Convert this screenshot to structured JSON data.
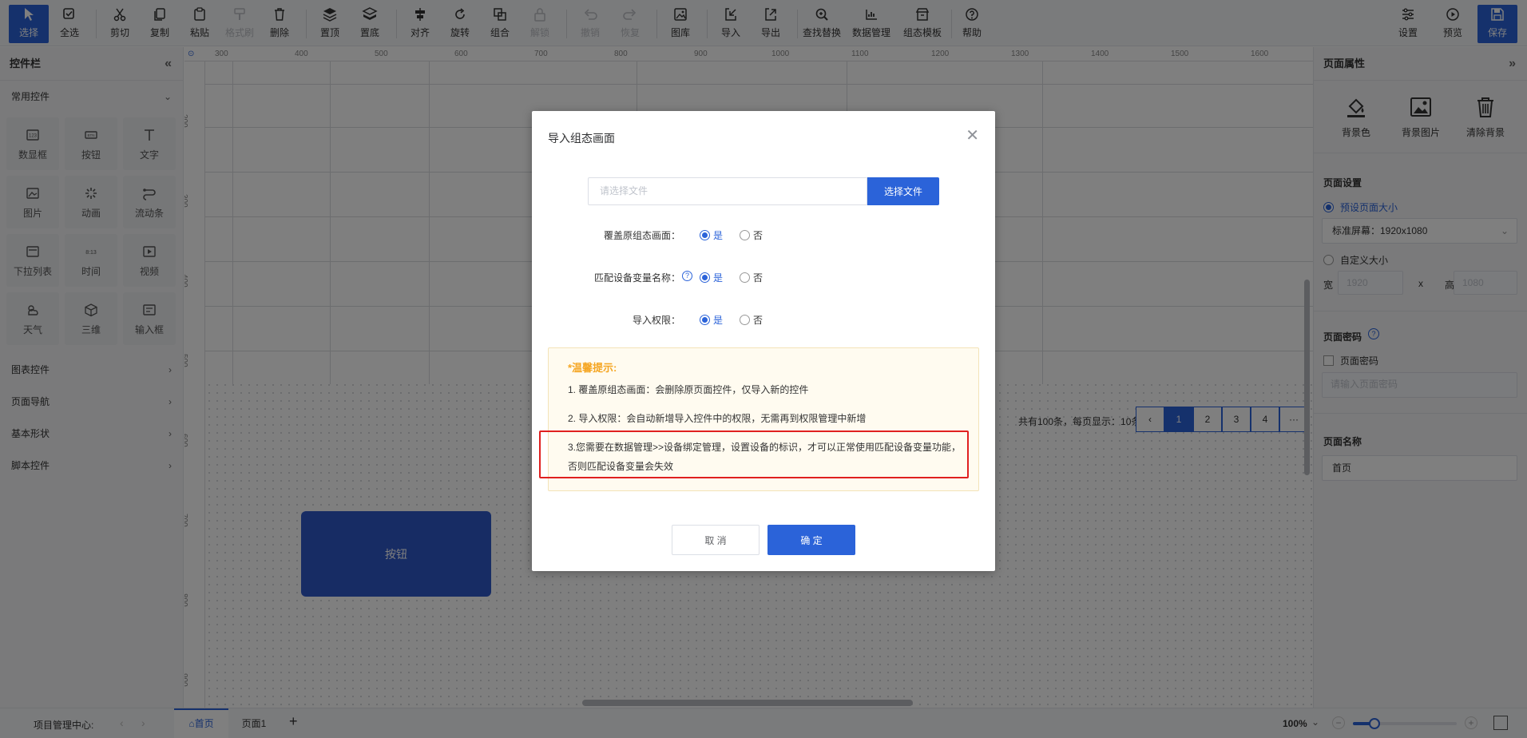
{
  "toolbar": {
    "tools": [
      {
        "label": "选择",
        "icon": "cursor-icon",
        "state": "active"
      },
      {
        "label": "全选",
        "icon": "select-all-icon"
      },
      {
        "label": "剪切",
        "icon": "scissors-icon"
      },
      {
        "label": "复制",
        "icon": "copy-icon"
      },
      {
        "label": "粘贴",
        "icon": "paste-icon"
      },
      {
        "label": "格式刷",
        "icon": "format-brush-icon",
        "state": "disabled"
      },
      {
        "label": "删除",
        "icon": "trash-icon"
      },
      {
        "label": "置顶",
        "icon": "bring-to-front-icon"
      },
      {
        "label": "置底",
        "icon": "send-to-back-icon"
      },
      {
        "label": "对齐",
        "icon": "align-icon"
      },
      {
        "label": "旋转",
        "icon": "rotate-icon"
      },
      {
        "label": "组合",
        "icon": "group-icon"
      },
      {
        "label": "解锁",
        "icon": "lock-icon",
        "state": "disabled"
      },
      {
        "label": "撤销",
        "icon": "undo-icon",
        "state": "disabled"
      },
      {
        "label": "恢复",
        "icon": "redo-icon",
        "state": "disabled"
      },
      {
        "label": "图库",
        "icon": "image-library-icon"
      },
      {
        "label": "导入",
        "icon": "import-icon"
      },
      {
        "label": "导出",
        "icon": "export-icon"
      },
      {
        "label": "查找替换",
        "icon": "find-replace-icon"
      },
      {
        "label": "数据管理",
        "icon": "data-management-icon"
      },
      {
        "label": "组态模板",
        "icon": "template-icon"
      },
      {
        "label": "帮助",
        "icon": "help-icon"
      }
    ],
    "right_tools": [
      {
        "label": "设置",
        "icon": "settings-icon"
      },
      {
        "label": "预览",
        "icon": "preview-icon"
      },
      {
        "label": "保存",
        "icon": "save-icon"
      }
    ]
  },
  "left_panel": {
    "title": "控件栏",
    "common_group": "常用控件",
    "controls": [
      {
        "label": "数显框",
        "icon": "numeric-display-icon"
      },
      {
        "label": "按钮",
        "icon": "button-icon"
      },
      {
        "label": "文字",
        "icon": "text-icon"
      },
      {
        "label": "图片",
        "icon": "picture-icon"
      },
      {
        "label": "动画",
        "icon": "animation-icon"
      },
      {
        "label": "流动条",
        "icon": "flow-bar-icon"
      },
      {
        "label": "下拉列表",
        "icon": "dropdown-list-icon"
      },
      {
        "label": "时间",
        "icon": "time-icon"
      },
      {
        "label": "视频",
        "icon": "video-icon"
      },
      {
        "label": "天气",
        "icon": "weather-icon"
      },
      {
        "label": "三维",
        "icon": "3d-cube-icon"
      },
      {
        "label": "输入框",
        "icon": "input-box-icon"
      }
    ],
    "other_groups": [
      "图表控件",
      "页面导航",
      "基本形状",
      "脚本控件"
    ]
  },
  "canvas": {
    "ruler_top": [
      "300",
      "400",
      "500",
      "600",
      "700",
      "800",
      "900",
      "1000",
      "1100",
      "1200",
      "1300",
      "1400",
      "1500",
      "1600"
    ],
    "ruler_left": [
      "200",
      "300",
      "400",
      "500",
      "600",
      "700",
      "800",
      "900"
    ],
    "pager_info": "共有100条，每页显示：10条",
    "pages": [
      "1",
      "2",
      "3",
      "4",
      "···"
    ],
    "current_page": "1",
    "button_label": "按钮"
  },
  "right_panel": {
    "title": "页面属性",
    "bg_buttons": [
      {
        "label": "背景色",
        "icon": "paint-bucket-icon"
      },
      {
        "label": "背景图片",
        "icon": "image-icon"
      },
      {
        "label": "清除背景",
        "icon": "trash-icon"
      }
    ],
    "page_settings_title": "页面设置",
    "preset_size_label": "预设页面大小",
    "preset_size_value": "标准屏幕：1920x1080",
    "custom_size_label": "自定义大小",
    "width_label": "宽",
    "width_value": "1920",
    "x_label": "x",
    "height_label": "高",
    "height_value": "1080",
    "password_title": "页面密码",
    "password_checkbox_label": "页面密码",
    "password_placeholder": "请输入页面密码",
    "page_name_title": "页面名称",
    "page_name_value": "首页"
  },
  "bottom_bar": {
    "project_label": "项目管理中心:",
    "tabs": [
      "首页",
      "页面1"
    ],
    "zoom": "100%"
  },
  "modal": {
    "title": "导入组态画面",
    "file_placeholder": "请选择文件",
    "file_button": "选择文件",
    "rows": [
      {
        "label": "覆盖原组态画面：",
        "yes": "是",
        "no": "否",
        "help": false
      },
      {
        "label": "匹配设备变量名称：",
        "yes": "是",
        "no": "否",
        "help": true
      },
      {
        "label": "导入权限：",
        "yes": "是",
        "no": "否",
        "help": false
      }
    ],
    "tips_title": "*温馨提示:",
    "tips": [
      "1. 覆盖原组态画面：会删除原页面控件，仅导入新的控件",
      "2. 导入权限：会自动新增导入控件中的权限，无需再到权限管理中新增",
      "3.您需要在数据管理>>设备绑定管理，设置设备的标识，才可以正常使用匹配设备变量功能，否则匹配设备变量会失效"
    ],
    "cancel_label": "取 消",
    "ok_label": "确 定"
  },
  "colors": {
    "accent": "#2b63d9",
    "highlight": "#e02020",
    "tip_title": "#f5a623"
  }
}
